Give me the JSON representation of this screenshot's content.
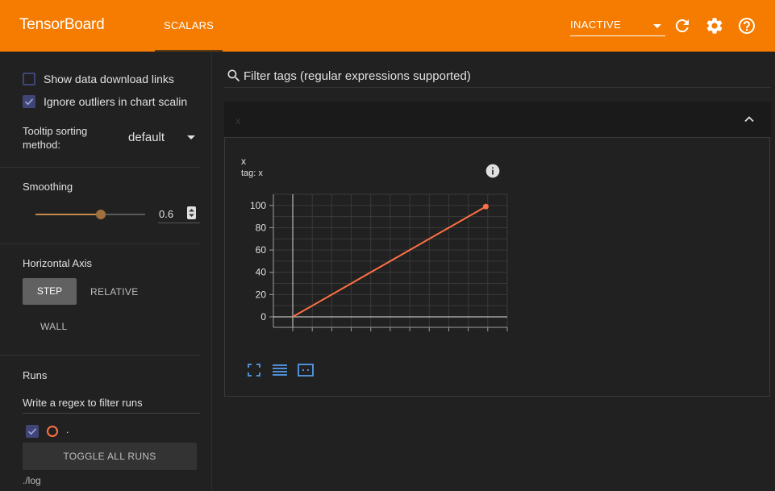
{
  "app": {
    "title": "TensorBoard",
    "active_tab": "SCALARS",
    "run_selector_value": "INACTIVE",
    "accent_color": "#f57c00"
  },
  "sidebar": {
    "show_download_label": "Show data download links",
    "ignore_outliers_label": "Ignore outliers in chart scalin",
    "tooltip_sort_label": "Tooltip sorting method:",
    "tooltip_sort_value": "default",
    "smoothing_title": "Smoothing",
    "smoothing_value": "0.6",
    "horizontal_axis_title": "Horizontal Axis",
    "axis_buttons": {
      "step": "STEP",
      "relative": "RELATIVE",
      "wall": "WALL"
    },
    "runs_title": "Runs",
    "runs_filter_placeholder": "Write a regex to filter runs",
    "run_name": ".",
    "run_color": "#ff7043",
    "toggle_all_label": "TOGGLE ALL RUNS",
    "logdir": "./log"
  },
  "main": {
    "filter_placeholder": "Filter tags (regular expressions supported)",
    "group_name": "x",
    "card": {
      "title": "x",
      "tag_label": "tag: x"
    }
  },
  "chart_data": {
    "type": "line",
    "title": "x",
    "xlabel": "",
    "ylabel": "",
    "series": [
      {
        "color": "#ff7043",
        "x": [
          0,
          99
        ],
        "values": [
          0,
          99
        ]
      }
    ],
    "yticks": [
      "0",
      "20",
      "40",
      "60",
      "80",
      "100"
    ],
    "ylim": [
      0,
      110
    ],
    "xlim": [
      0,
      110
    ],
    "grid": true
  }
}
